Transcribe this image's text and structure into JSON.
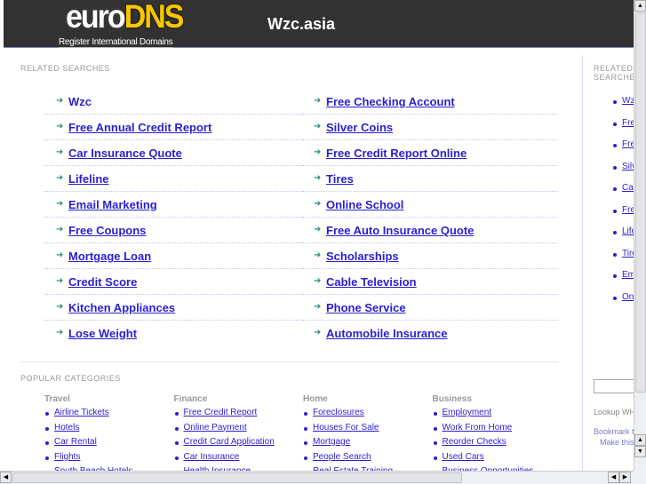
{
  "header": {
    "logo_euro": "euro",
    "logo_dns": "DNS",
    "logo_tagline": "Register International Domains",
    "site_title": "Wzc.asia"
  },
  "related": {
    "title": "RELATED SEARCHES",
    "left": [
      "Wzc",
      "Free Annual Credit Report",
      "Car Insurance Quote",
      "Lifeline",
      "Email Marketing",
      "Free Coupons",
      "Mortgage Loan",
      "Credit Score",
      "Kitchen Appliances",
      "Lose Weight"
    ],
    "right": [
      "Free Checking Account",
      "Silver Coins",
      "Free Credit Report Online",
      "Tires",
      "Online School",
      "Free Auto Insurance Quote",
      "Scholarships",
      "Cable Television",
      "Phone Service",
      "Automobile Insurance"
    ]
  },
  "popular": {
    "title": "POPULAR CATEGORIES",
    "columns": [
      {
        "heading": "Travel",
        "items": [
          "Airline Tickets",
          "Hotels",
          "Car Rental",
          "Flights",
          "South Beach Hotels"
        ]
      },
      {
        "heading": "Finance",
        "items": [
          "Free Credit Report",
          "Online Payment",
          "Credit Card Application",
          "Car Insurance",
          "Health Insurance"
        ]
      },
      {
        "heading": "Home",
        "items": [
          "Foreclosures",
          "Houses For Sale",
          "Mortgage",
          "People Search",
          "Real Estate Training"
        ]
      },
      {
        "heading": "Business",
        "items": [
          "Employment",
          "Work From Home",
          "Reorder Checks",
          "Used Cars",
          "Business Opportunities"
        ]
      }
    ]
  },
  "sidebar": {
    "title": "RELATED SEARCHES",
    "items": [
      "Wzc",
      "Free Checking Account",
      "Free Annual Credit Report",
      "Silver Coins",
      "Car Insurance Quote",
      "Free Credit Report Online",
      "Lifeline",
      "Tires",
      "Email Marketing",
      "Online School"
    ],
    "lookup": "Lookup WHOIS",
    "bookmark": "Bookmark this page",
    "make": "Make this your homepage"
  },
  "colors": {
    "link": "#2a1fd0",
    "header_bg": "#333132",
    "arrow": "#2f8f83"
  }
}
